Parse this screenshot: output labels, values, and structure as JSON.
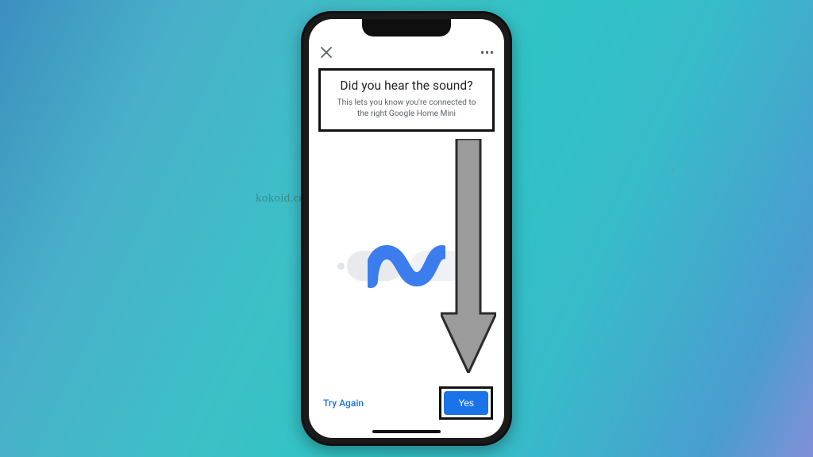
{
  "topbar": {
    "close_label": "Close",
    "more_label": "More options"
  },
  "header": {
    "title": "Did you hear the sound?",
    "subtitle": "This lets you know you're connected to the right Google Home Mini"
  },
  "illustration": {
    "name": "sound-wave-graphic",
    "accent_color": "#3b7ded"
  },
  "buttons": {
    "try_again": "Try Again",
    "yes": "Yes"
  },
  "annotations": {
    "arrow_target": "yes-button",
    "highlight_1": "title-block",
    "highlight_2": "yes-button"
  },
  "watermark": "kokoid.com"
}
